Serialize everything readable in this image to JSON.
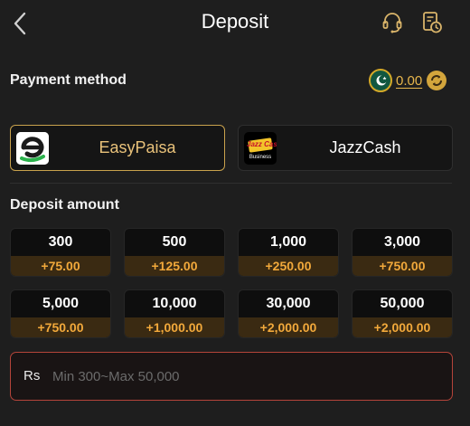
{
  "header": {
    "title": "Deposit",
    "back_icon": "chevron-left-icon",
    "support_icon": "headset-icon",
    "records_icon": "clock-document-icon"
  },
  "payment": {
    "title": "Payment method",
    "balance": "0.00",
    "methods": [
      {
        "label": "EasyPaisa",
        "selected": true
      },
      {
        "label": "JazzCash",
        "selected": false
      }
    ],
    "jazzcash_logo_text": "Jazz Cash",
    "jazzcash_logo_sub": "Business"
  },
  "deposit": {
    "title": "Deposit amount",
    "amounts": [
      {
        "value": "300",
        "bonus": "+75.00"
      },
      {
        "value": "500",
        "bonus": "+125.00"
      },
      {
        "value": "1,000",
        "bonus": "+250.00"
      },
      {
        "value": "3,000",
        "bonus": "+750.00"
      },
      {
        "value": "5,000",
        "bonus": "+750.00"
      },
      {
        "value": "10,000",
        "bonus": "+1,000.00"
      },
      {
        "value": "30,000",
        "bonus": "+2,000.00"
      },
      {
        "value": "50,000",
        "bonus": "+2,000.00"
      }
    ],
    "currency": "Rs",
    "placeholder": "Min 300~Max 50,000"
  },
  "colors": {
    "background": "#1e1e1e",
    "accent_gold": "#e9c27a",
    "bonus_orange": "#f2a93b",
    "input_border": "#b5443a"
  }
}
